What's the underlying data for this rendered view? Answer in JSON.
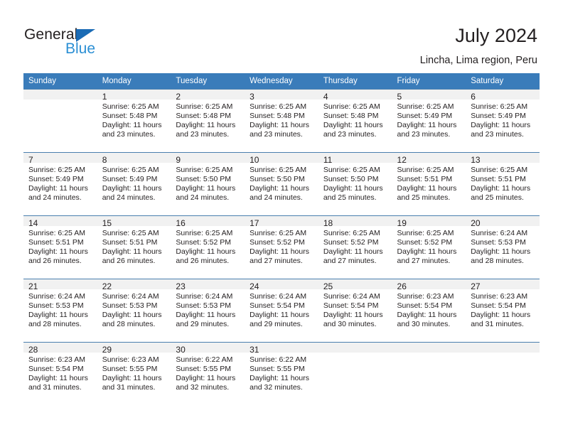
{
  "brand": {
    "name_part1": "General",
    "name_part2": "Blue",
    "triangle_color": "#1a6bb5",
    "blue_text_color": "#2b8fd4"
  },
  "header": {
    "title": "July 2024",
    "subtitle": "Lincha, Lima region, Peru",
    "header_bg": "#3a7cba",
    "daynum_bg": "#f1f1f1"
  },
  "weekdays": [
    "Sunday",
    "Monday",
    "Tuesday",
    "Wednesday",
    "Thursday",
    "Friday",
    "Saturday"
  ],
  "labels": {
    "sunrise_prefix": "Sunrise: ",
    "sunset_prefix": "Sunset: ",
    "daylight_prefix": "Daylight: "
  },
  "weeks": [
    [
      {
        "day": "",
        "empty": true
      },
      {
        "day": "1",
        "sunrise": "Sunrise: 6:25 AM",
        "sunset": "Sunset: 5:48 PM",
        "daylight_line1": "Daylight: 11 hours",
        "daylight_line2": "and 23 minutes."
      },
      {
        "day": "2",
        "sunrise": "Sunrise: 6:25 AM",
        "sunset": "Sunset: 5:48 PM",
        "daylight_line1": "Daylight: 11 hours",
        "daylight_line2": "and 23 minutes."
      },
      {
        "day": "3",
        "sunrise": "Sunrise: 6:25 AM",
        "sunset": "Sunset: 5:48 PM",
        "daylight_line1": "Daylight: 11 hours",
        "daylight_line2": "and 23 minutes."
      },
      {
        "day": "4",
        "sunrise": "Sunrise: 6:25 AM",
        "sunset": "Sunset: 5:48 PM",
        "daylight_line1": "Daylight: 11 hours",
        "daylight_line2": "and 23 minutes."
      },
      {
        "day": "5",
        "sunrise": "Sunrise: 6:25 AM",
        "sunset": "Sunset: 5:49 PM",
        "daylight_line1": "Daylight: 11 hours",
        "daylight_line2": "and 23 minutes."
      },
      {
        "day": "6",
        "sunrise": "Sunrise: 6:25 AM",
        "sunset": "Sunset: 5:49 PM",
        "daylight_line1": "Daylight: 11 hours",
        "daylight_line2": "and 23 minutes."
      }
    ],
    [
      {
        "day": "7",
        "sunrise": "Sunrise: 6:25 AM",
        "sunset": "Sunset: 5:49 PM",
        "daylight_line1": "Daylight: 11 hours",
        "daylight_line2": "and 24 minutes."
      },
      {
        "day": "8",
        "sunrise": "Sunrise: 6:25 AM",
        "sunset": "Sunset: 5:49 PM",
        "daylight_line1": "Daylight: 11 hours",
        "daylight_line2": "and 24 minutes."
      },
      {
        "day": "9",
        "sunrise": "Sunrise: 6:25 AM",
        "sunset": "Sunset: 5:50 PM",
        "daylight_line1": "Daylight: 11 hours",
        "daylight_line2": "and 24 minutes."
      },
      {
        "day": "10",
        "sunrise": "Sunrise: 6:25 AM",
        "sunset": "Sunset: 5:50 PM",
        "daylight_line1": "Daylight: 11 hours",
        "daylight_line2": "and 24 minutes."
      },
      {
        "day": "11",
        "sunrise": "Sunrise: 6:25 AM",
        "sunset": "Sunset: 5:50 PM",
        "daylight_line1": "Daylight: 11 hours",
        "daylight_line2": "and 25 minutes."
      },
      {
        "day": "12",
        "sunrise": "Sunrise: 6:25 AM",
        "sunset": "Sunset: 5:51 PM",
        "daylight_line1": "Daylight: 11 hours",
        "daylight_line2": "and 25 minutes."
      },
      {
        "day": "13",
        "sunrise": "Sunrise: 6:25 AM",
        "sunset": "Sunset: 5:51 PM",
        "daylight_line1": "Daylight: 11 hours",
        "daylight_line2": "and 25 minutes."
      }
    ],
    [
      {
        "day": "14",
        "sunrise": "Sunrise: 6:25 AM",
        "sunset": "Sunset: 5:51 PM",
        "daylight_line1": "Daylight: 11 hours",
        "daylight_line2": "and 26 minutes."
      },
      {
        "day": "15",
        "sunrise": "Sunrise: 6:25 AM",
        "sunset": "Sunset: 5:51 PM",
        "daylight_line1": "Daylight: 11 hours",
        "daylight_line2": "and 26 minutes."
      },
      {
        "day": "16",
        "sunrise": "Sunrise: 6:25 AM",
        "sunset": "Sunset: 5:52 PM",
        "daylight_line1": "Daylight: 11 hours",
        "daylight_line2": "and 26 minutes."
      },
      {
        "day": "17",
        "sunrise": "Sunrise: 6:25 AM",
        "sunset": "Sunset: 5:52 PM",
        "daylight_line1": "Daylight: 11 hours",
        "daylight_line2": "and 27 minutes."
      },
      {
        "day": "18",
        "sunrise": "Sunrise: 6:25 AM",
        "sunset": "Sunset: 5:52 PM",
        "daylight_line1": "Daylight: 11 hours",
        "daylight_line2": "and 27 minutes."
      },
      {
        "day": "19",
        "sunrise": "Sunrise: 6:25 AM",
        "sunset": "Sunset: 5:52 PM",
        "daylight_line1": "Daylight: 11 hours",
        "daylight_line2": "and 27 minutes."
      },
      {
        "day": "20",
        "sunrise": "Sunrise: 6:24 AM",
        "sunset": "Sunset: 5:53 PM",
        "daylight_line1": "Daylight: 11 hours",
        "daylight_line2": "and 28 minutes."
      }
    ],
    [
      {
        "day": "21",
        "sunrise": "Sunrise: 6:24 AM",
        "sunset": "Sunset: 5:53 PM",
        "daylight_line1": "Daylight: 11 hours",
        "daylight_line2": "and 28 minutes."
      },
      {
        "day": "22",
        "sunrise": "Sunrise: 6:24 AM",
        "sunset": "Sunset: 5:53 PM",
        "daylight_line1": "Daylight: 11 hours",
        "daylight_line2": "and 28 minutes."
      },
      {
        "day": "23",
        "sunrise": "Sunrise: 6:24 AM",
        "sunset": "Sunset: 5:53 PM",
        "daylight_line1": "Daylight: 11 hours",
        "daylight_line2": "and 29 minutes."
      },
      {
        "day": "24",
        "sunrise": "Sunrise: 6:24 AM",
        "sunset": "Sunset: 5:54 PM",
        "daylight_line1": "Daylight: 11 hours",
        "daylight_line2": "and 29 minutes."
      },
      {
        "day": "25",
        "sunrise": "Sunrise: 6:24 AM",
        "sunset": "Sunset: 5:54 PM",
        "daylight_line1": "Daylight: 11 hours",
        "daylight_line2": "and 30 minutes."
      },
      {
        "day": "26",
        "sunrise": "Sunrise: 6:23 AM",
        "sunset": "Sunset: 5:54 PM",
        "daylight_line1": "Daylight: 11 hours",
        "daylight_line2": "and 30 minutes."
      },
      {
        "day": "27",
        "sunrise": "Sunrise: 6:23 AM",
        "sunset": "Sunset: 5:54 PM",
        "daylight_line1": "Daylight: 11 hours",
        "daylight_line2": "and 31 minutes."
      }
    ],
    [
      {
        "day": "28",
        "sunrise": "Sunrise: 6:23 AM",
        "sunset": "Sunset: 5:54 PM",
        "daylight_line1": "Daylight: 11 hours",
        "daylight_line2": "and 31 minutes."
      },
      {
        "day": "29",
        "sunrise": "Sunrise: 6:23 AM",
        "sunset": "Sunset: 5:55 PM",
        "daylight_line1": "Daylight: 11 hours",
        "daylight_line2": "and 31 minutes."
      },
      {
        "day": "30",
        "sunrise": "Sunrise: 6:22 AM",
        "sunset": "Sunset: 5:55 PM",
        "daylight_line1": "Daylight: 11 hours",
        "daylight_line2": "and 32 minutes."
      },
      {
        "day": "31",
        "sunrise": "Sunrise: 6:22 AM",
        "sunset": "Sunset: 5:55 PM",
        "daylight_line1": "Daylight: 11 hours",
        "daylight_line2": "and 32 minutes."
      },
      {
        "day": "",
        "empty": true
      },
      {
        "day": "",
        "empty": true
      },
      {
        "day": "",
        "empty": true
      }
    ]
  ]
}
